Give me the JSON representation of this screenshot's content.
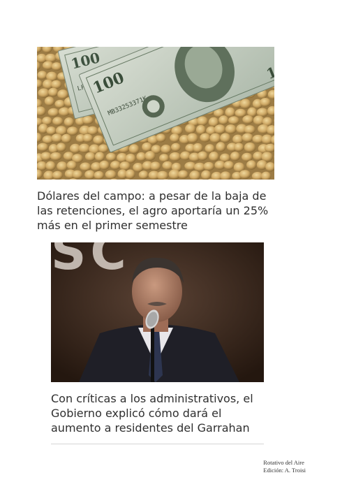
{
  "articles": [
    {
      "headline": "Dólares del campo: a pesar de la baja de las retenciones, el agro aportaría un 25% más en el primer semestre",
      "banknote_serials": [
        "LF11837625L",
        "MB33253371K"
      ],
      "banknote_value": "100"
    },
    {
      "headline": "Con críticas a los administrativos, el Gobierno explicó cómo dará el aumento a residentes del Garrahan",
      "backdrop_letters": "SC"
    }
  ],
  "credit": {
    "line1": "Rotativo del Aire",
    "line2": "Edición: A. Troisi"
  },
  "colors": {
    "soy": "#c9a867",
    "note_green": "#a9b9a3",
    "backdrop": "#3a2a22",
    "suit": "#1e1e26"
  }
}
